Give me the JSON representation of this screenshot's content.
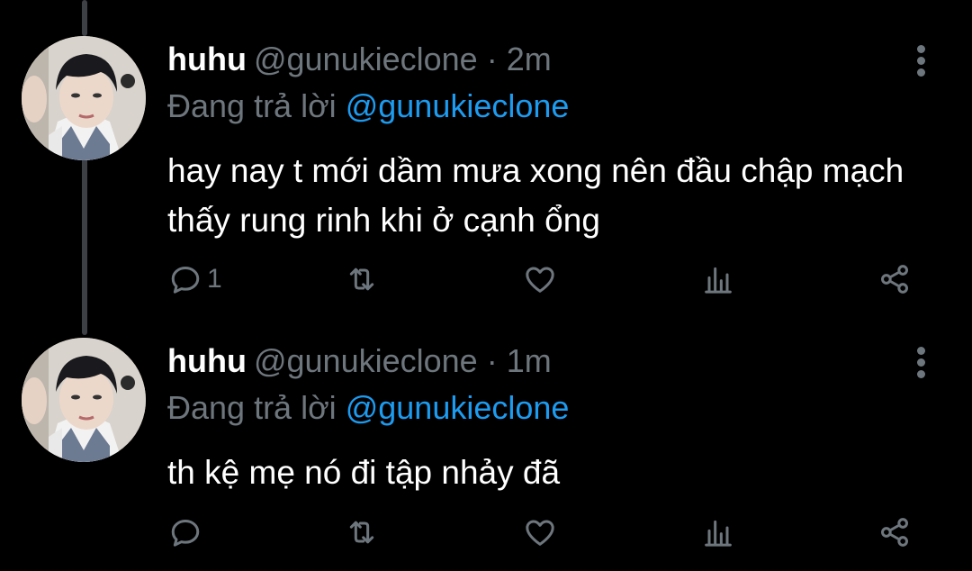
{
  "tweets": [
    {
      "name": "huhu",
      "handle": "@gunukieclone",
      "separator": "·",
      "time": "2m",
      "replying_prefix": "Đang trả lời",
      "replying_to": "@gunukieclone",
      "text": "hay nay t mới dầm mưa xong nên đầu chập mạch thấy rung rinh khi ở cạnh ổng",
      "reply_count": "1"
    },
    {
      "name": "huhu",
      "handle": "@gunukieclone",
      "separator": "·",
      "time": "1m",
      "replying_prefix": "Đang trả lời",
      "replying_to": "@gunukieclone",
      "text": "th kệ mẹ nó đi tập nhảy đã",
      "reply_count": ""
    }
  ],
  "colors": {
    "background": "#000000",
    "muted": "#6e767d",
    "accent": "#1d9bf0",
    "thread_line": "#3d4146"
  },
  "icons": [
    "reply-icon",
    "retweet-icon",
    "like-icon",
    "views-icon",
    "share-icon",
    "more-icon"
  ]
}
